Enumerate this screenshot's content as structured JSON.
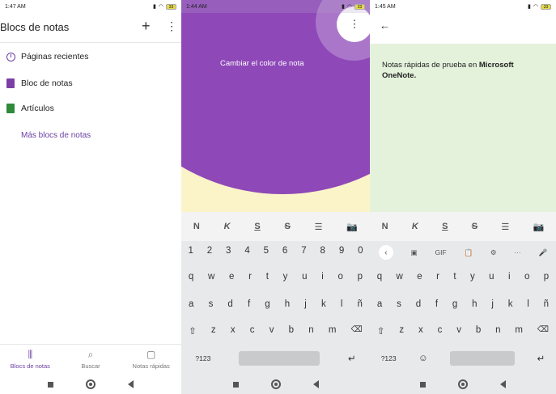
{
  "panel1": {
    "status": {
      "time": "1:47 AM",
      "battery": "33"
    },
    "title": "Blocs de notas",
    "add_label": "+",
    "more_label": "⋮",
    "items": [
      {
        "label": "Páginas recientes",
        "icon": "clock-icon",
        "color": "#6a3ea1"
      },
      {
        "label": "Bloc de notas",
        "icon": "notebook-icon",
        "color": "#7b3fa6"
      },
      {
        "label": "Artículos",
        "icon": "notebook-icon",
        "color": "#2f8a3a"
      }
    ],
    "more_notebooks": "Más blocs de notas",
    "bottom_nav": [
      {
        "label": "Blocs de notas",
        "glyph": "⫼",
        "active": true
      },
      {
        "label": "Buscar",
        "glyph": "⌕",
        "active": false
      },
      {
        "label": "Notas rápidas",
        "glyph": "▢",
        "active": false
      }
    ]
  },
  "panel2": {
    "status": {
      "time": "1:44 AM",
      "battery": "33"
    },
    "tooltip": "Cambiar el color de nota",
    "more_label": "⋮",
    "back_label": "←",
    "note_color": "#fbf4c8",
    "accent": "#8e48b8"
  },
  "panel3": {
    "status": {
      "time": "1:45 AM",
      "battery": "33"
    },
    "back_label": "←",
    "note_text_plain": "Notas rápidas de prueba en ",
    "note_text_bold": "Microsoft OneNote.",
    "note_color": "#e4f2dc"
  },
  "format_bar": {
    "bold": "N",
    "italic": "K",
    "underline": "S",
    "strike": "S",
    "list": "☰",
    "camera": "📷"
  },
  "keyboard": {
    "numbers": [
      "1",
      "2",
      "3",
      "4",
      "5",
      "6",
      "7",
      "8",
      "9",
      "0"
    ],
    "row1": [
      "q",
      "w",
      "e",
      "r",
      "t",
      "y",
      "u",
      "i",
      "o",
      "p"
    ],
    "row2": [
      "a",
      "s",
      "d",
      "f",
      "g",
      "h",
      "j",
      "k",
      "l",
      "ñ"
    ],
    "row3": [
      "⇧",
      "z",
      "x",
      "c",
      "v",
      "b",
      "n",
      "m",
      "⌫"
    ],
    "symbols": "?123",
    "emoji": "☺",
    "enter": "↵",
    "strip": [
      "‹",
      "▣",
      "GIF",
      "📋",
      "⚙",
      "···",
      "🎤"
    ]
  }
}
